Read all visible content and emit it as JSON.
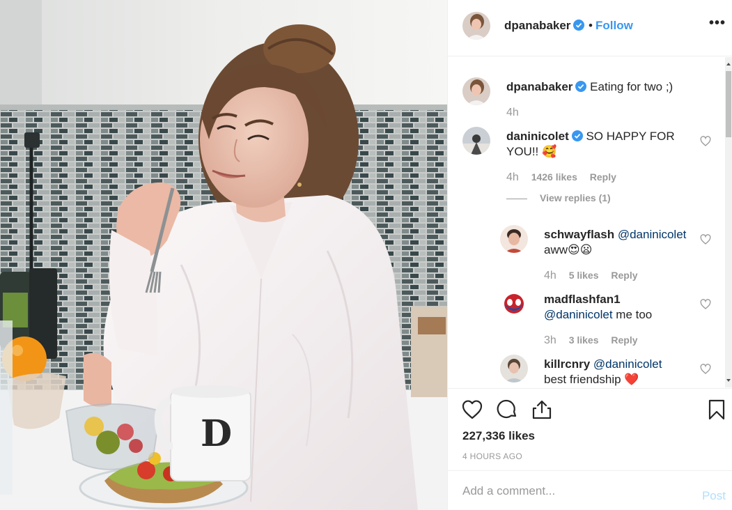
{
  "post": {
    "author": "dpanabaker",
    "separator": "•",
    "follow_label": "Follow",
    "more_label": "•••",
    "caption_author": "dpanabaker",
    "caption_text": "Eating for two ;)",
    "caption_time": "4h",
    "likes": "227,336 likes",
    "posted_ago": "4 HOURS AGO",
    "photo_description": "woman in white shirt eating avocado toast at kitchen counter with mug marked D"
  },
  "comments": [
    {
      "author": "daninicolet",
      "verified": true,
      "text": "SO HAPPY FOR YOU!! 🥰",
      "time": "4h",
      "likes": "1426 likes",
      "reply": "Reply",
      "view_replies": "View replies (1)"
    },
    {
      "author": "schwayflash",
      "mention": "@daninicolet",
      "text": "aww😍😦",
      "time": "4h",
      "likes": "5 likes",
      "reply": "Reply"
    },
    {
      "author": "madflashfan1",
      "mention": "@daninicolet",
      "text": "me too",
      "time": "3h",
      "likes": "3 likes",
      "reply": "Reply"
    },
    {
      "author": "killrcnry",
      "mention": "@daninicolet",
      "text": "best friendship ❤️"
    }
  ],
  "add_comment": {
    "placeholder": "Add a comment...",
    "post_label": "Post"
  },
  "icons": {
    "like": "heart-icon",
    "comment": "comment-icon",
    "share": "share-icon",
    "save": "bookmark-icon",
    "verified": "verified-badge-icon"
  },
  "colors": {
    "link_blue": "#3897f0",
    "mention_blue": "#003569",
    "muted_gray": "#999999",
    "post_disabled": "#b2dffc",
    "verified_blue": "#3897f0"
  }
}
